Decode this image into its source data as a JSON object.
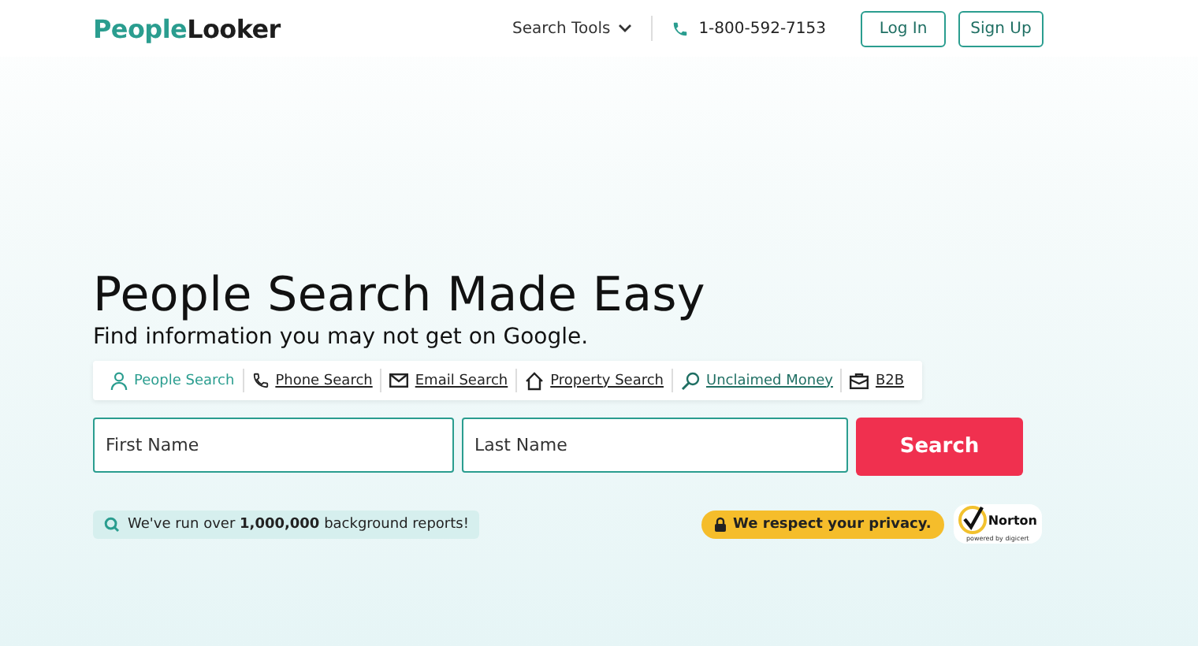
{
  "header": {
    "logo": {
      "first": "People",
      "second": "Looker"
    },
    "search_tools": "Search Tools",
    "phone": "1-800-592-7153",
    "buttons": [
      "Log In",
      "Sign Up"
    ]
  },
  "hero": {
    "title": "People Search Made Easy",
    "subtitle": "Find information you may not get on Google."
  },
  "tabs": [
    {
      "label": "People Search",
      "kind": "tab",
      "selected": true
    },
    {
      "label": "Phone Search",
      "kind": "tab",
      "selected": false
    },
    {
      "label": "Email Search",
      "kind": "tab",
      "selected": false
    },
    {
      "label": "Property Search",
      "kind": "tab",
      "selected": false
    },
    {
      "label": "Unclaimed Money",
      "kind": "link",
      "selected": false
    },
    {
      "label": "B2B",
      "kind": "tab",
      "selected": false
    }
  ],
  "form": {
    "first_name": {
      "placeholder": "First Name"
    },
    "last_name": {
      "placeholder": "Last Name"
    },
    "button": "Search"
  },
  "reports_note": "We've run over **1,000,000** background reports!",
  "privacy_badge": "We respect your privacy.",
  "norton": {
    "name": "Norton",
    "caption": "powered by digicert"
  }
}
